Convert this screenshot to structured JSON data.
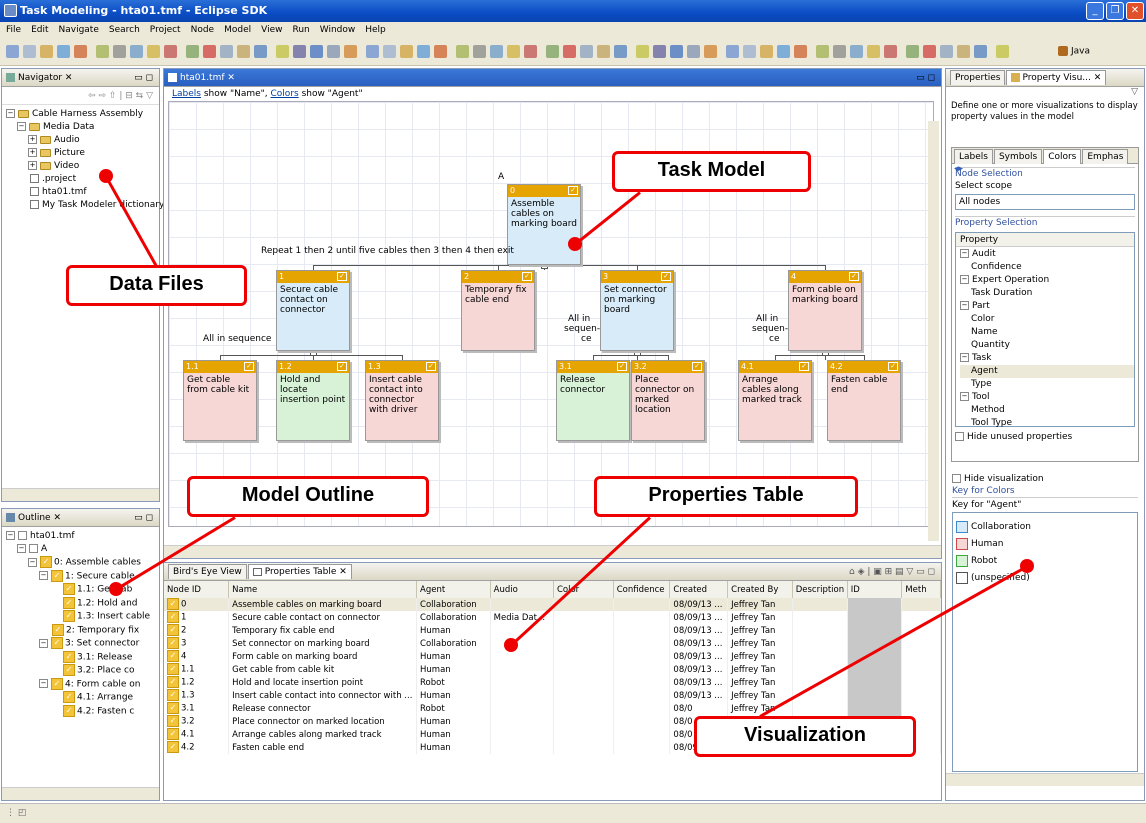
{
  "window": {
    "title": "Task Modeling - hta01.tmf - Eclipse SDK"
  },
  "menu": [
    "File",
    "Edit",
    "Navigate",
    "Search",
    "Project",
    "Node",
    "Model",
    "View",
    "Run",
    "Window",
    "Help"
  ],
  "perspective": "Java",
  "navigator": {
    "tab": "Navigator",
    "items": [
      {
        "label": "Cable Harness Assembly",
        "indent": 0,
        "type": "folder",
        "exp": "−"
      },
      {
        "label": "Media Data",
        "indent": 1,
        "type": "folder",
        "exp": "−"
      },
      {
        "label": "Audio",
        "indent": 2,
        "type": "folder",
        "exp": "+"
      },
      {
        "label": "Picture",
        "indent": 2,
        "type": "folder",
        "exp": "+"
      },
      {
        "label": "Video",
        "indent": 2,
        "type": "folder",
        "exp": "+"
      },
      {
        "label": ".project",
        "indent": 1,
        "type": "file",
        "exp": ""
      },
      {
        "label": "hta01.tmf",
        "indent": 1,
        "type": "file",
        "exp": ""
      },
      {
        "label": "My Task Modeler dictionary",
        "indent": 1,
        "type": "file",
        "exp": ""
      }
    ]
  },
  "outline": {
    "tab": "Outline",
    "items": [
      {
        "label": "hta01.tmf",
        "indent": 0,
        "chk": false,
        "exp": "−"
      },
      {
        "label": "A",
        "indent": 1,
        "chk": false,
        "exp": "−"
      },
      {
        "label": "0: Assemble cables",
        "indent": 2,
        "chk": true,
        "exp": "−"
      },
      {
        "label": "1: Secure cable",
        "indent": 3,
        "chk": true,
        "exp": "−"
      },
      {
        "label": "1.1: Get cab",
        "indent": 4,
        "chk": true,
        "exp": ""
      },
      {
        "label": "1.2: Hold and",
        "indent": 4,
        "chk": true,
        "exp": ""
      },
      {
        "label": "1.3: Insert cable",
        "indent": 4,
        "chk": true,
        "exp": ""
      },
      {
        "label": "2: Temporary fix",
        "indent": 3,
        "chk": true,
        "exp": ""
      },
      {
        "label": "3: Set connector",
        "indent": 3,
        "chk": true,
        "exp": "−"
      },
      {
        "label": "3.1: Release",
        "indent": 4,
        "chk": true,
        "exp": ""
      },
      {
        "label": "3.2: Place co",
        "indent": 4,
        "chk": true,
        "exp": ""
      },
      {
        "label": "4: Form cable on",
        "indent": 3,
        "chk": true,
        "exp": "−"
      },
      {
        "label": "4.1: Arrange",
        "indent": 4,
        "chk": true,
        "exp": ""
      },
      {
        "label": "4.2: Fasten c",
        "indent": 4,
        "chk": true,
        "exp": ""
      }
    ]
  },
  "editor": {
    "tab": "hta01.tmf",
    "info_prefix": "Labels",
    "info_mid": " show \"Name\", ",
    "info_colors": "Colors",
    "info_suffix": " show \"Agent\"",
    "root_label": "A",
    "repeat_plan": "Repeat 1 then 2 until five cables then 3 then 4 then exit",
    "plan_seq1": "All in sequence",
    "plan_seq3a": "All in",
    "plan_seq3b": "sequen-",
    "plan_seq3c": "ce",
    "plan_seq4a": "All in",
    "plan_seq4b": "sequen-",
    "plan_seq4c": "ce",
    "nodes": {
      "n0": {
        "id": "0",
        "name": "Assemble cables on marking board"
      },
      "n1": {
        "id": "1",
        "name": "Secure cable contact on connector"
      },
      "n2": {
        "id": "2",
        "name": "Temporary fix cable end"
      },
      "n3": {
        "id": "3",
        "name": "Set connector on marking board"
      },
      "n4": {
        "id": "4",
        "name": "Form cable on marking board"
      },
      "n11": {
        "id": "1.1",
        "name": "Get cable from cable kit"
      },
      "n12": {
        "id": "1.2",
        "name": "Hold and locate insertion point"
      },
      "n13": {
        "id": "1.3",
        "name": "Insert cable contact into connector with driver"
      },
      "n31": {
        "id": "3.1",
        "name": "Release connector"
      },
      "n32": {
        "id": "3.2",
        "name": "Place connector on marked location"
      },
      "n41": {
        "id": "4.1",
        "name": "Arrange cables along marked track"
      },
      "n42": {
        "id": "4.2",
        "name": "Fasten cable end"
      }
    }
  },
  "bottom": {
    "tab1": "Bird's Eye View",
    "tab2": "Properties Table",
    "columns": [
      "Node ID",
      "Name",
      "Agent",
      "Audio",
      "Color",
      "Confidence",
      "Created",
      "Created By",
      "Description",
      "ID",
      "Meth"
    ],
    "rows": [
      [
        "0",
        "Assemble cables on marking board",
        "Collaboration",
        "",
        "",
        "",
        "08/09/13 ...",
        "Jeffrey Tan"
      ],
      [
        "1",
        "Secure cable contact on connector",
        "Collaboration",
        "Media Dat...",
        "",
        "",
        "08/09/13 ...",
        "Jeffrey Tan"
      ],
      [
        "2",
        "Temporary fix cable end",
        "Human",
        "",
        "",
        "",
        "08/09/13 ...",
        "Jeffrey Tan"
      ],
      [
        "3",
        "Set connector on marking board",
        "Collaboration",
        "",
        "",
        "",
        "08/09/13 ...",
        "Jeffrey Tan"
      ],
      [
        "4",
        "Form cable on marking board",
        "Human",
        "",
        "",
        "",
        "08/09/13 ...",
        "Jeffrey Tan"
      ],
      [
        "1.1",
        "Get cable from cable kit",
        "Human",
        "",
        "",
        "",
        "08/09/13 ...",
        "Jeffrey Tan"
      ],
      [
        "1.2",
        "Hold and locate insertion point",
        "Robot",
        "",
        "",
        "",
        "08/09/13 ...",
        "Jeffrey Tan"
      ],
      [
        "1.3",
        "Insert cable contact into connector with ...",
        "Human",
        "",
        "",
        "",
        "08/09/13 ...",
        "Jeffrey Tan"
      ],
      [
        "3.1",
        "Release connector",
        "Robot",
        "",
        "",
        "",
        "08/0",
        "Jeffrey Tan"
      ],
      [
        "3.2",
        "Place connector on marked location",
        "Human",
        "",
        "",
        "",
        "08/0",
        "Jeffrey Tan"
      ],
      [
        "4.1",
        "Arrange cables along marked track",
        "Human",
        "",
        "",
        "",
        "08/0",
        "Jeffrey Tan"
      ],
      [
        "4.2",
        "Fasten cable end",
        "Human",
        "",
        "",
        "",
        "08/09/13 ...",
        "Jeffrey Tan"
      ]
    ]
  },
  "right": {
    "tab1": "Properties",
    "tab2": "Property Visu...",
    "description": "Define one or more visualizations to display property values in the model",
    "subtabs": [
      "Labels",
      "Symbols",
      "Colors",
      "Emphas"
    ],
    "node_selection": "Node Selection",
    "select_scope": "Select scope",
    "scope_value": "All nodes",
    "property_selection": "Property Selection",
    "property_header": "Property",
    "props": [
      {
        "label": "Audit",
        "indent": 0,
        "exp": "−"
      },
      {
        "label": "Confidence",
        "indent": 1,
        "exp": ""
      },
      {
        "label": "Expert Operation",
        "indent": 0,
        "exp": "−"
      },
      {
        "label": "Task Duration",
        "indent": 1,
        "exp": ""
      },
      {
        "label": "Part",
        "indent": 0,
        "exp": "−"
      },
      {
        "label": "Color",
        "indent": 1,
        "exp": ""
      },
      {
        "label": "Name",
        "indent": 1,
        "exp": ""
      },
      {
        "label": "Quantity",
        "indent": 1,
        "exp": ""
      },
      {
        "label": "Task",
        "indent": 0,
        "exp": "−"
      },
      {
        "label": "Agent",
        "indent": 1,
        "exp": "",
        "sel": true
      },
      {
        "label": "Type",
        "indent": 1,
        "exp": ""
      },
      {
        "label": "Tool",
        "indent": 0,
        "exp": "−"
      },
      {
        "label": "Method",
        "indent": 1,
        "exp": ""
      },
      {
        "label": "Tool Type",
        "indent": 1,
        "exp": ""
      }
    ],
    "hide_unused": "Hide unused properties",
    "hide_vis": "Hide visualization",
    "key_colors": "Key for Colors",
    "key_agent": "Key for \"Agent\"",
    "keys": [
      {
        "label": "Collaboration",
        "color": "#d7ebf8",
        "border": "#3a8ad0"
      },
      {
        "label": "Human",
        "color": "#f7d6d6",
        "border": "#d04848"
      },
      {
        "label": "Robot",
        "color": "#d8f2d8",
        "border": "#3aa83a"
      },
      {
        "label": "(unspecified)",
        "color": "#ffffff",
        "border": "#555555"
      }
    ]
  },
  "callouts": {
    "task_model": "Task Model",
    "data_files": "Data Files",
    "model_outline": "Model Outline",
    "properties_table": "Properties Table",
    "visualization": "Visualization"
  }
}
